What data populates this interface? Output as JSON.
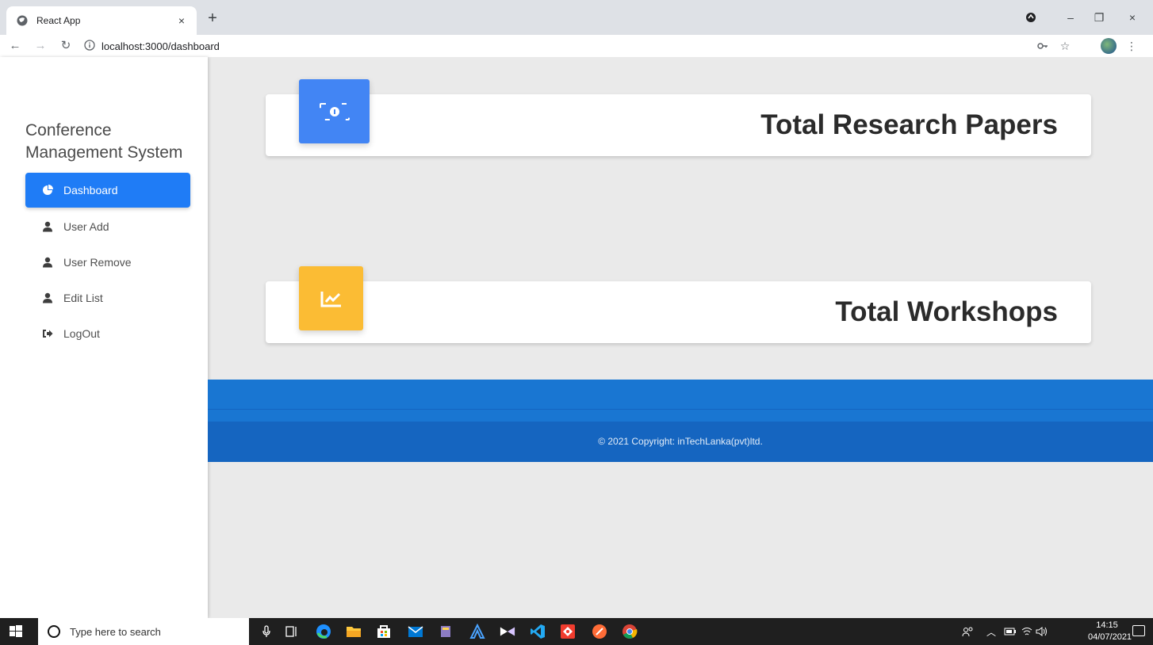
{
  "browser": {
    "tab_title": "React App",
    "tab_close": "×",
    "new_tab": "+",
    "url": "localhost:3000/dashboard",
    "window_controls": {
      "minimize": "–",
      "maximize": "❐",
      "close": "×"
    }
  },
  "sidebar": {
    "brand_line1": "Conference",
    "brand_line2": "Management System",
    "items": [
      {
        "label": "Dashboard",
        "icon": "pie-chart-icon",
        "active": true
      },
      {
        "label": "User Add",
        "icon": "user-icon",
        "active": false
      },
      {
        "label": "User Remove",
        "icon": "user-icon",
        "active": false
      },
      {
        "label": "Edit List",
        "icon": "user-icon",
        "active": false
      },
      {
        "label": "LogOut",
        "icon": "sign-out-icon",
        "active": false
      }
    ]
  },
  "cards": [
    {
      "label": "Total Research Papers",
      "icon": "money-bill-icon",
      "color": "#4285f4"
    },
    {
      "label": "Total Workshops",
      "icon": "chart-line-icon",
      "color": "#fbbc34"
    }
  ],
  "footer": {
    "copyright": "© 2021 Copyright: inTechLanka(pvt)ltd.",
    "colors": {
      "top": "#1976d2",
      "bottom": "#1565c0"
    }
  },
  "taskbar": {
    "search_placeholder": "Type here to search",
    "time": "14:15",
    "date": "04/07/2021"
  },
  "colors": {
    "accent": "#1f7cf6",
    "background": "#eaeaea"
  }
}
